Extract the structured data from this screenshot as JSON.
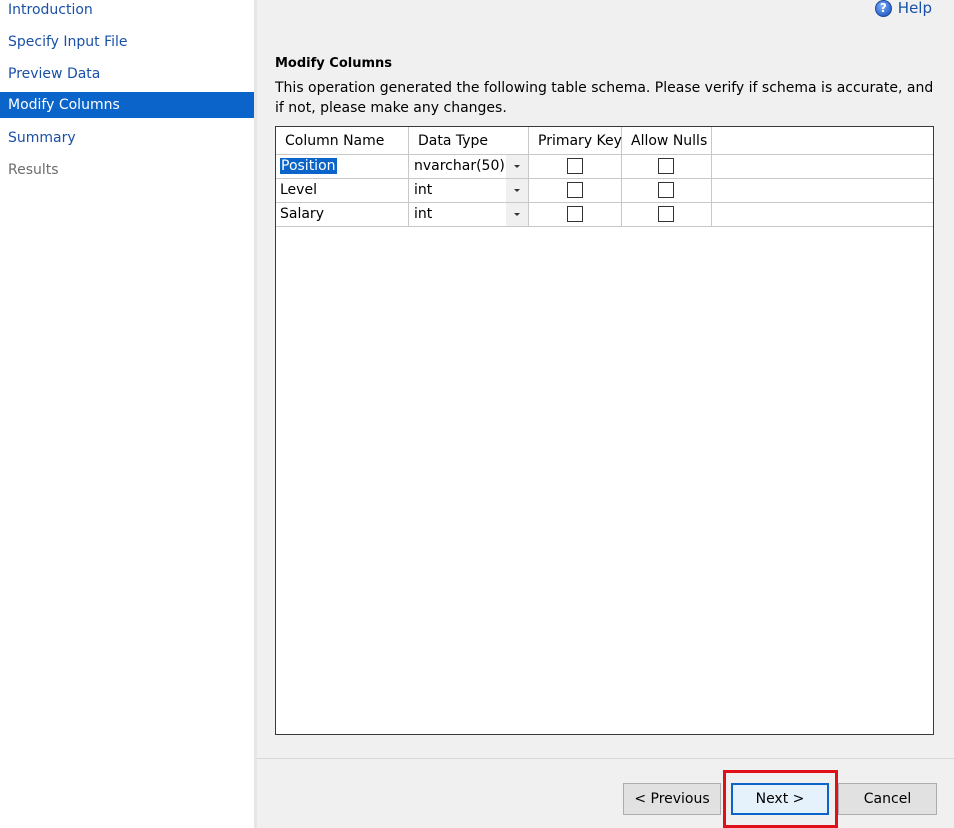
{
  "sidebar": {
    "items": [
      {
        "label": "Introduction",
        "state": "link"
      },
      {
        "label": "Specify Input File",
        "state": "link"
      },
      {
        "label": "Preview Data",
        "state": "link"
      },
      {
        "label": "Modify Columns",
        "state": "active"
      },
      {
        "label": "Summary",
        "state": "link"
      },
      {
        "label": "Results",
        "state": "disabled"
      }
    ]
  },
  "help": {
    "label": "Help",
    "icon": "help-icon"
  },
  "main": {
    "title": "Modify Columns",
    "description": "This operation generated the following table schema. Please verify if schema is accurate, and if not, please make any changes."
  },
  "grid": {
    "headers": [
      "Column Name",
      "Data Type",
      "Primary Key",
      "Allow Nulls"
    ],
    "rows": [
      {
        "name": "Position",
        "type": "nvarchar(50)",
        "primary_key": false,
        "allow_nulls": false,
        "selected": true
      },
      {
        "name": "Level",
        "type": "int",
        "primary_key": false,
        "allow_nulls": false,
        "selected": false
      },
      {
        "name": "Salary",
        "type": "int",
        "primary_key": false,
        "allow_nulls": false,
        "selected": false
      }
    ]
  },
  "footer": {
    "previous_label": "< Previous",
    "next_label": "Next >",
    "cancel_label": "Cancel"
  },
  "colors": {
    "accent": "#0a64c9",
    "link": "#1a50a8",
    "highlight": "#e0101a",
    "panel": "#f0f0f0"
  }
}
